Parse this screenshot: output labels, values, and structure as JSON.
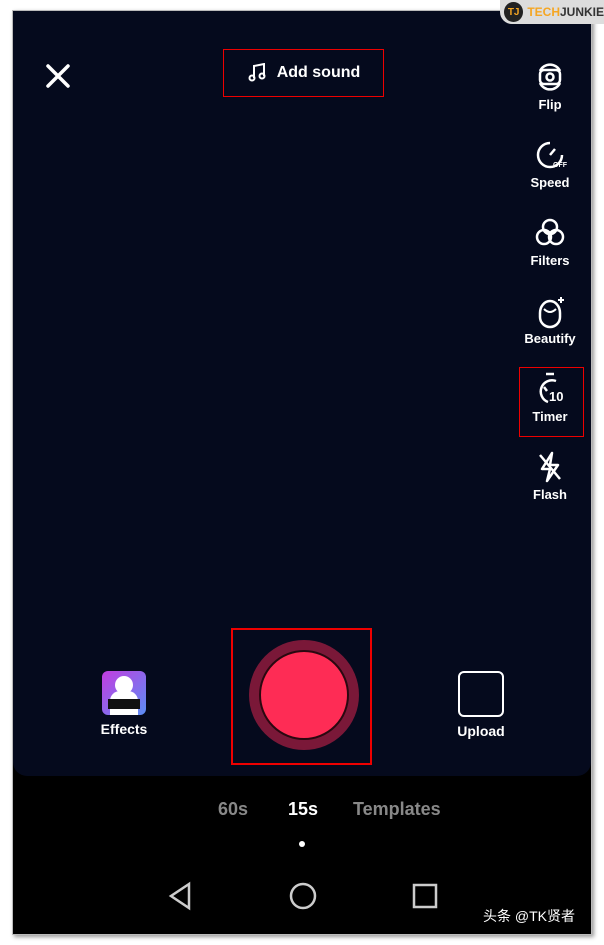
{
  "watermark_logo": "TECHJUNKIE",
  "header": {
    "add_sound": "Add sound"
  },
  "tools": [
    {
      "label": "Flip",
      "icon": "flip-camera-icon"
    },
    {
      "label": "Speed",
      "icon": "speed-icon"
    },
    {
      "label": "Filters",
      "icon": "filters-icon"
    },
    {
      "label": "Beautify",
      "icon": "beautify-icon"
    },
    {
      "label": "Timer",
      "icon": "timer-icon"
    },
    {
      "label": "Flash",
      "icon": "flash-off-icon"
    }
  ],
  "bottom": {
    "effects": "Effects",
    "upload": "Upload",
    "record_color": "#fe2c55"
  },
  "modes": [
    "60s",
    "15s",
    "Templates"
  ],
  "selected_mode": "15s",
  "watermark": "头条 @TK贤者"
}
